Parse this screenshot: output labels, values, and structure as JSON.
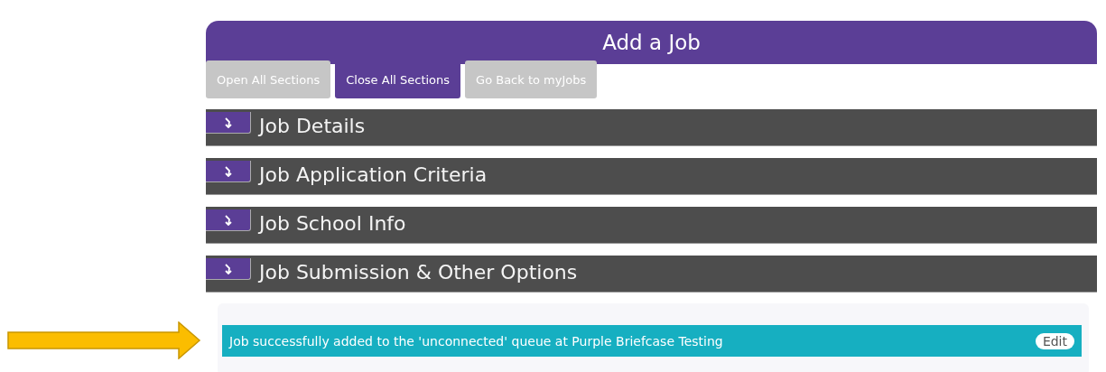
{
  "header": {
    "title": "Add a Job"
  },
  "actions": [
    {
      "label": "Open All Sections",
      "selected": false
    },
    {
      "label": "Close All Sections",
      "selected": true
    },
    {
      "label": "Go Back to myJobs",
      "selected": false
    }
  ],
  "sections": [
    {
      "title": "Job Details",
      "expanded": false
    },
    {
      "title": "Job Application Criteria",
      "expanded": false
    },
    {
      "title": "Job School Info",
      "expanded": false
    },
    {
      "title": "Job Submission & Other Options",
      "expanded": false
    }
  ],
  "notification": {
    "message": "Job successfully added to the 'unconnected' queue at Purple Briefcase Testing",
    "button": "Edit"
  }
}
